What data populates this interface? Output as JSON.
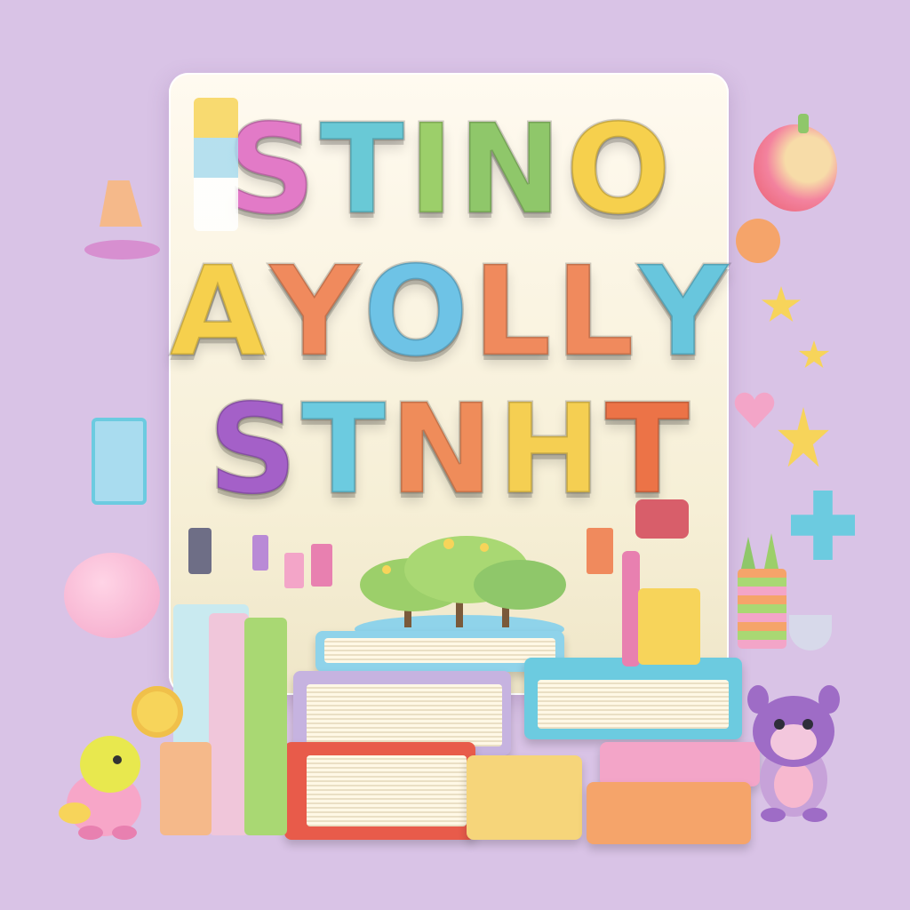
{
  "letters": {
    "row1": [
      {
        "char": "S",
        "color": "#e27ac7"
      },
      {
        "char": "T",
        "color": "#69c9d6"
      },
      {
        "char": "I",
        "color": "#9ccf6a"
      },
      {
        "char": "N",
        "color": "#8fc76a"
      },
      {
        "char": "O",
        "color": "#f6d04d"
      }
    ],
    "row2": [
      {
        "char": "A",
        "color": "#f6d04d"
      },
      {
        "char": "Y",
        "color": "#f08a5d"
      },
      {
        "char": "O",
        "color": "#6ec3e6"
      },
      {
        "char": "L",
        "color": "#f08a5d"
      },
      {
        "char": "L",
        "color": "#f08a5d"
      },
      {
        "char": "Y",
        "color": "#68c6dd"
      }
    ],
    "row3": [
      {
        "char": "S",
        "color": "#a460c8"
      },
      {
        "char": "T",
        "color": "#6ccbe0"
      },
      {
        "char": "N",
        "color": "#ef8c5a"
      },
      {
        "char": "H",
        "color": "#f5cf52"
      },
      {
        "char": "T",
        "color": "#ec7347"
      }
    ]
  },
  "colors": {
    "background": "#d9c3e6",
    "board": "#fff7e8",
    "pink": "#f3a5c8",
    "mint": "#a8e0c8",
    "peach": "#f5b98a",
    "sky": "#8fd3ea",
    "purple": "#b07fd4",
    "yellow": "#f7d45a"
  },
  "icons": [
    "book-stack-icon",
    "tree-icon",
    "toy-bear-icon",
    "toy-bird-icon",
    "apple-icon",
    "heart-icon",
    "star-icon",
    "plus-icon",
    "pencil-cup-icon"
  ]
}
